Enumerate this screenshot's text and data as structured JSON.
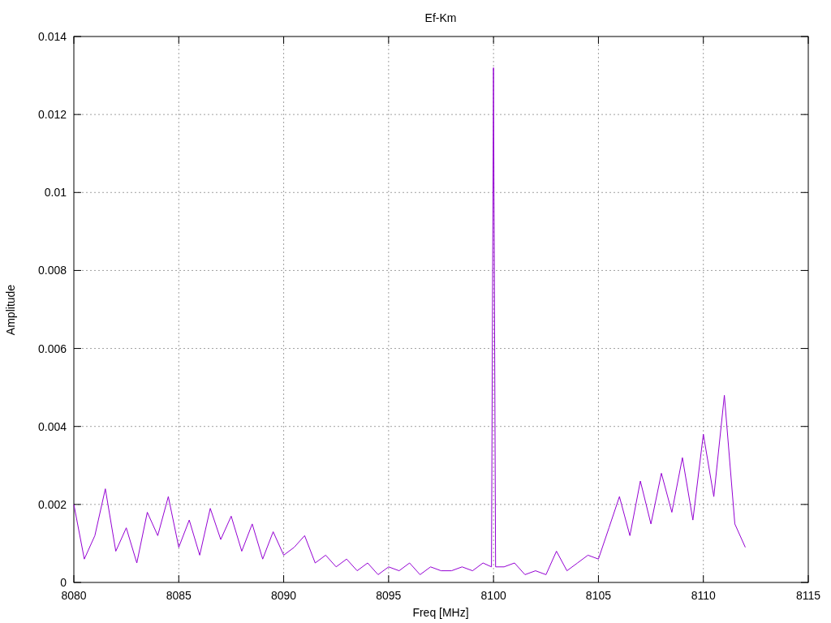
{
  "chart": {
    "chart_data": {
      "type": "line",
      "grid": true,
      "title": "Ef-Km",
      "xlabel": "Freq [MHz]",
      "ylabel": "Amplitude",
      "xlim": [
        8080,
        8115
      ],
      "ylim": [
        0,
        0.014
      ],
      "xticks": [
        {
          "value": 8080,
          "label": "8080"
        },
        {
          "value": 8085,
          "label": "8085"
        },
        {
          "value": 8090,
          "label": "8090"
        },
        {
          "value": 8095,
          "label": "8095"
        },
        {
          "value": 8100,
          "label": "8100"
        },
        {
          "value": 8105,
          "label": "8105"
        },
        {
          "value": 8110,
          "label": "8110"
        },
        {
          "value": 8115,
          "label": "8115"
        }
      ],
      "yticks": [
        {
          "value": 0,
          "label": "0"
        },
        {
          "value": 0.002,
          "label": "0.002"
        },
        {
          "value": 0.004,
          "label": "0.004"
        },
        {
          "value": 0.006,
          "label": "0.006"
        },
        {
          "value": 0.008,
          "label": "0.008"
        },
        {
          "value": 0.01,
          "label": "0.01"
        },
        {
          "value": 0.012,
          "label": "0.012"
        },
        {
          "value": 0.014,
          "label": "0.014"
        }
      ],
      "x": [
        8080,
        8080.5,
        8081,
        8081.5,
        8082,
        8082.5,
        8083,
        8083.5,
        8084,
        8084.5,
        8085,
        8085.5,
        8086,
        8086.5,
        8087,
        8087.5,
        8088,
        8088.5,
        8089,
        8089.5,
        8090,
        8090.5,
        8091,
        8091.5,
        8092,
        8092.5,
        8093,
        8093.5,
        8094,
        8094.5,
        8095,
        8095.5,
        8096,
        8096.5,
        8097,
        8097.5,
        8098,
        8098.5,
        8099,
        8099.5,
        8099.9,
        8100,
        8100.1,
        8100.5,
        8101,
        8101.5,
        8102,
        8102.5,
        8103,
        8103.5,
        8104,
        8104.5,
        8105,
        8105.5,
        8106,
        8106.5,
        8107,
        8107.5,
        8108,
        8108.5,
        8109,
        8109.5,
        8110,
        8110.5,
        8111,
        8111.5,
        8112
      ],
      "series": [
        {
          "color": "#9400d3",
          "values": [
            0.002,
            0.0006,
            0.0012,
            0.0024,
            0.0008,
            0.0014,
            0.0005,
            0.0018,
            0.0012,
            0.0022,
            0.0009,
            0.0016,
            0.0007,
            0.0019,
            0.0011,
            0.0017,
            0.0008,
            0.0015,
            0.0006,
            0.0013,
            0.0007,
            0.0009,
            0.0012,
            0.0005,
            0.0007,
            0.0004,
            0.0006,
            0.0003,
            0.0005,
            0.0002,
            0.0004,
            0.0003,
            0.0005,
            0.0002,
            0.0004,
            0.0003,
            0.0003,
            0.0004,
            0.0003,
            0.0005,
            0.0004,
            0.0132,
            0.0004,
            0.0004,
            0.0005,
            0.0002,
            0.0003,
            0.0002,
            0.0008,
            0.0003,
            0.0005,
            0.0007,
            0.0006,
            0.0014,
            0.0022,
            0.0012,
            0.0026,
            0.0015,
            0.0028,
            0.0018,
            0.0032,
            0.0016,
            0.0038,
            0.0022,
            0.0048,
            0.0015,
            0.0009
          ]
        }
      ]
    }
  }
}
